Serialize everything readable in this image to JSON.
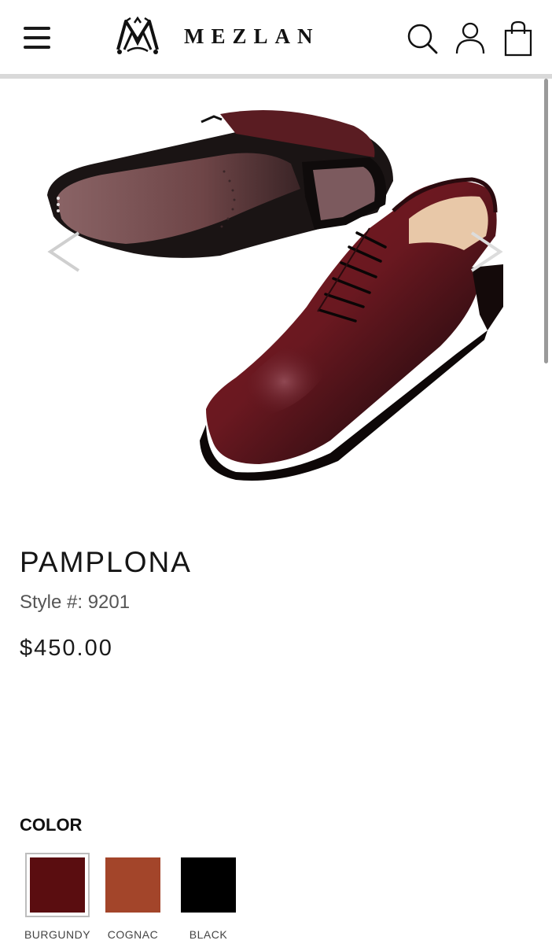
{
  "header": {
    "brand_name": "MEZLAN",
    "icons": [
      "menu-icon",
      "brand-logo",
      "search-icon",
      "account-icon",
      "shopping-bag-icon"
    ]
  },
  "gallery": {
    "prev_icon": "chevron-left-icon",
    "next_icon": "chevron-right-icon"
  },
  "product": {
    "name": "PAMPLONA",
    "style": "Style #: 9201",
    "price": "$450.00"
  },
  "color": {
    "heading": "COLOR",
    "selected": "BURGUNDY",
    "options": [
      {
        "label": "BURGUNDY",
        "hex": "#5a0d10"
      },
      {
        "label": "COGNAC",
        "hex": "#a3452a"
      },
      {
        "label": "BLACK",
        "hex": "#000000"
      }
    ]
  }
}
